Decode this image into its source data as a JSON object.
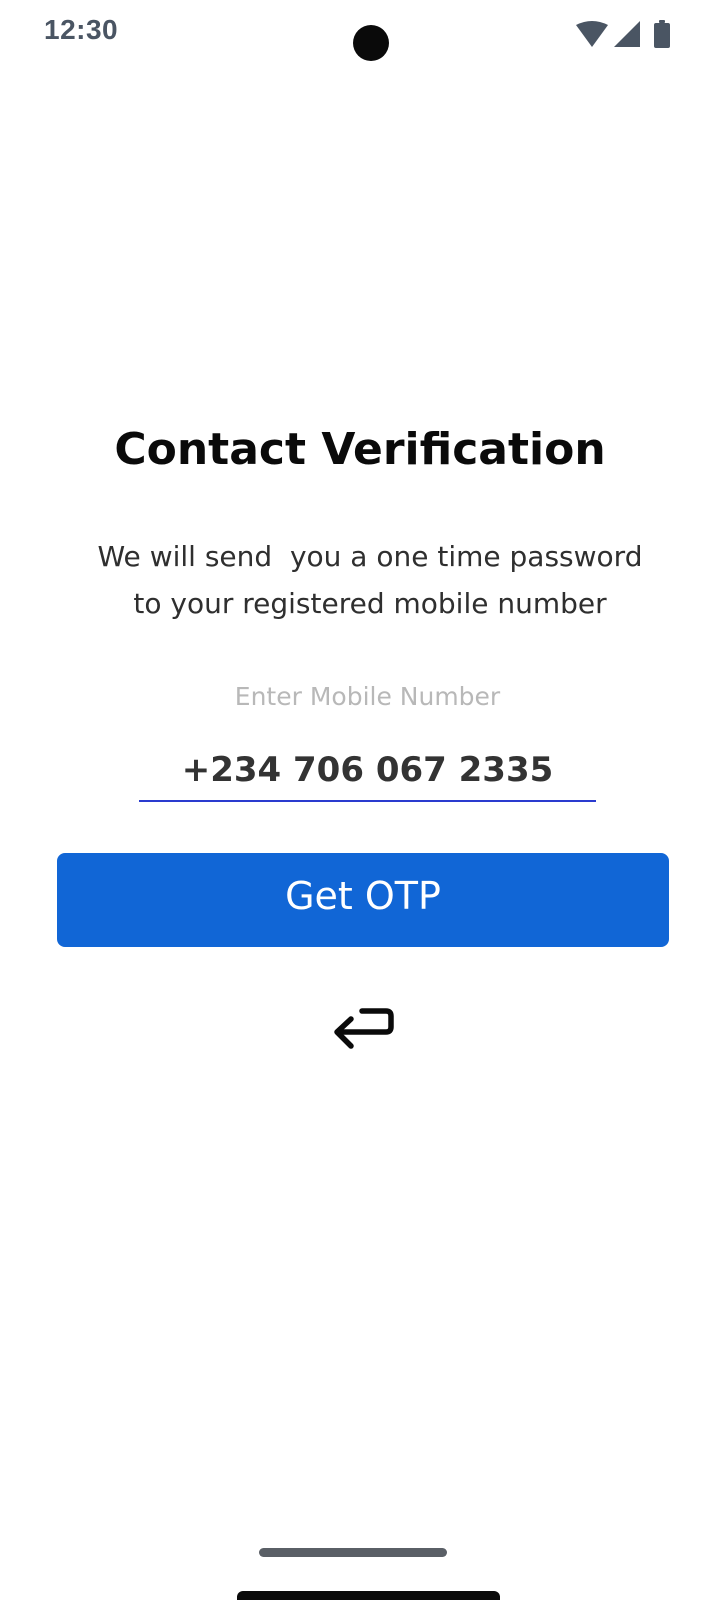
{
  "status_bar": {
    "time": "12:30",
    "icons": [
      "wifi-icon",
      "signal-icon",
      "battery-icon"
    ]
  },
  "verification": {
    "title": "Contact Verification",
    "subtitle": "We will send  you a one time password\nto your registered mobile number",
    "field_label": "Enter Mobile Number",
    "phone_value": "+234 706 067 2335",
    "button_label": "Get OTP",
    "back_icon": "return-arrow-icon"
  },
  "colors": {
    "primary": "#1166d6",
    "input_underline": "#2a3bcf",
    "label_gray": "#b8b8b8",
    "status_gray": "#4a5563"
  }
}
